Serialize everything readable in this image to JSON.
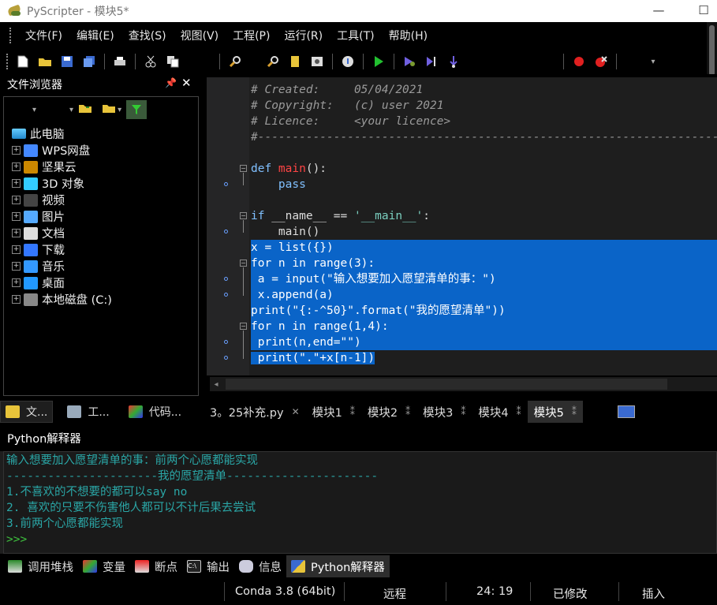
{
  "window": {
    "title": "PyScripter - 模块5*",
    "minimize": "—",
    "maximize": "☐"
  },
  "menu": [
    "文件(F)",
    "编辑(E)",
    "查找(S)",
    "视图(V)",
    "工程(P)",
    "运行(R)",
    "工具(T)",
    "帮助(H)"
  ],
  "file_browser": {
    "title": "文件浏览器",
    "pin": "ᵖ",
    "close": "✕",
    "root": "此电脑",
    "items": [
      "WPS网盘",
      "坚果云",
      "3D 对象",
      "视频",
      "图片",
      "文档",
      "下载",
      "音乐",
      "桌面",
      "本地磁盘 (C:)"
    ]
  },
  "left_tabs": [
    "文...",
    "工...",
    "代码..."
  ],
  "code_lines": [
    {
      "segs": [
        [
          "cm",
          "# Created:     05/04/2021"
        ]
      ]
    },
    {
      "segs": [
        [
          "cm",
          "# Copyright:   (c) user 2021"
        ]
      ]
    },
    {
      "segs": [
        [
          "cm",
          "# Licence:     <your licence>"
        ]
      ]
    },
    {
      "segs": [
        [
          "cm",
          "#-------------------------------------------------------------------------------"
        ]
      ]
    },
    {
      "segs": [
        [
          "",
          ""
        ]
      ]
    },
    {
      "segs": [
        [
          "kw",
          "def "
        ],
        [
          "fn",
          "main"
        ],
        [
          "",
          "():"
        ]
      ]
    },
    {
      "segs": [
        [
          "kw",
          "    pass"
        ]
      ]
    },
    {
      "segs": [
        [
          "",
          ""
        ]
      ]
    },
    {
      "segs": [
        [
          "kw",
          "if "
        ],
        [
          "",
          "__name__ == "
        ],
        [
          "str",
          "'__main__'"
        ],
        [
          "",
          ":"
        ]
      ]
    },
    {
      "segs": [
        [
          "",
          "    main()"
        ]
      ]
    },
    {
      "sel": true,
      "segs": [
        [
          "",
          "x = list({})"
        ]
      ]
    },
    {
      "sel": true,
      "segs": [
        [
          "",
          "for n in range(3):"
        ]
      ]
    },
    {
      "sel": true,
      "segs": [
        [
          "",
          ""
        ],
        [
          "",
          " a = input(\"输入想要加入愿望清单的事：\")"
        ]
      ]
    },
    {
      "sel": true,
      "segs": [
        [
          "",
          " x.append(a)"
        ]
      ]
    },
    {
      "sel": true,
      "segs": [
        [
          "",
          "print(\"{:-^50}\".format(\"我的愿望清单\"))"
        ]
      ]
    },
    {
      "sel": true,
      "segs": [
        [
          "",
          "for n in range(1,4):"
        ]
      ]
    },
    {
      "sel": true,
      "segs": [
        [
          "",
          " print(n,end=\"\")"
        ]
      ]
    },
    {
      "selpart": true,
      "segs": [
        [
          "",
          " print(\".\"+x[n-1])"
        ]
      ]
    }
  ],
  "editor_tabs": [
    {
      "label": "3。25补充.py",
      "close": "✕"
    },
    {
      "label": "模块1",
      "close": "⁑"
    },
    {
      "label": "模块2",
      "close": "⁑"
    },
    {
      "label": "模块3",
      "close": "⁑"
    },
    {
      "label": "模块4",
      "close": "⁑"
    },
    {
      "label": "模块5",
      "close": "⁑",
      "active": true
    }
  ],
  "interpreter": {
    "title": "Python解释器",
    "lines": [
      "输入想要加入愿望清单的事：前两个心愿都能实现",
      "----------------------我的愿望清单----------------------",
      "1.不喜欢的不想要的都可以say no",
      "2. 喜欢的只要不伤害他人都可以不计后果去尝试",
      "3.前两个心愿都能实现"
    ],
    "prompt": ">>>"
  },
  "bottom_tabs": [
    "调用堆栈",
    "变量",
    "断点",
    "输出",
    "信息",
    "Python解释器"
  ],
  "status": {
    "env": "Conda 3.8 (64bit)",
    "mode": "远程",
    "pos": "24: 19",
    "modified": "已修改",
    "insert": "插入"
  }
}
